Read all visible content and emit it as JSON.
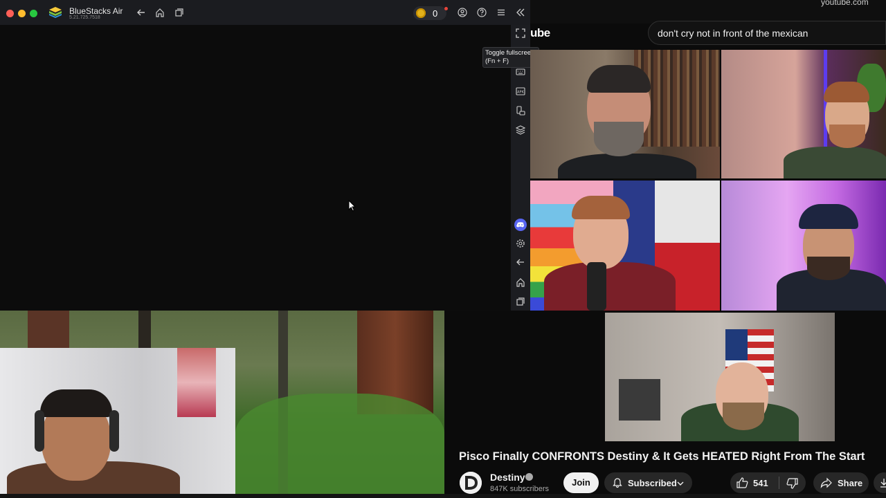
{
  "bluestacks": {
    "app_title": "BlueStacks Air",
    "version": "5.21.725.7518",
    "coin_count": "0",
    "tooltip_line1": "Toggle fullscreen",
    "tooltip_line2": "(Fn + F)"
  },
  "browser": {
    "url": "youtube.com"
  },
  "youtube": {
    "logo_fragment": "ube",
    "search_query": "don't cry not in front of the mexican",
    "video_title": "Pisco Finally CONFRONTS Destiny & It Gets HEATED Right From The Start",
    "channel_name": "Destiny",
    "subscribers": "847K subscribers",
    "join_label": "Join",
    "subscribed_label": "Subscribed",
    "like_count": "541",
    "share_label": "Share"
  },
  "colors": {
    "accent_discord": "#5865f2",
    "coin": "#e3b21b",
    "youtube_bg": "#0f0f0f"
  }
}
